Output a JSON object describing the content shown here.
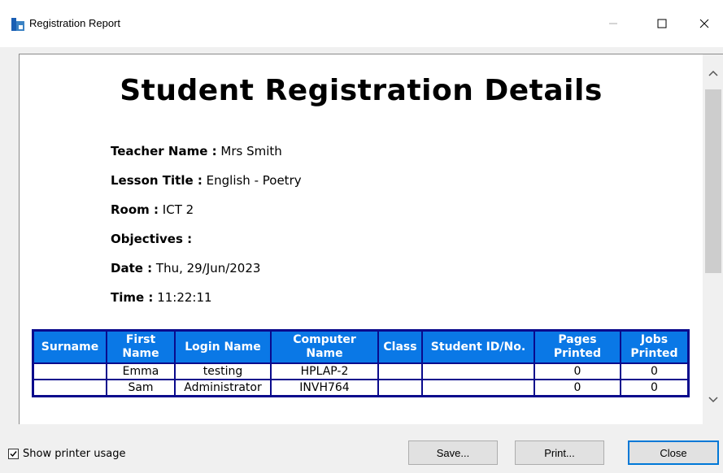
{
  "window": {
    "title": "Registration Report"
  },
  "report": {
    "title": "Student Registration Details",
    "fields": [
      {
        "label": "Teacher Name :",
        "value": "Mrs Smith"
      },
      {
        "label": "Lesson Title :",
        "value": "English - Poetry"
      },
      {
        "label": "Room :",
        "value": "ICT 2"
      },
      {
        "label": "Objectives :",
        "value": ""
      },
      {
        "label": "Date :",
        "value": "Thu, 29/Jun/2023"
      },
      {
        "label": "Time :",
        "value": "11:22:11"
      }
    ],
    "table": {
      "headers": [
        "Surname",
        "First Name",
        "Login Name",
        "Computer Name",
        "Class",
        "Student ID/No.",
        "Pages Printed",
        "Jobs Printed"
      ],
      "rows": [
        [
          "",
          "Emma",
          "testing",
          "HPLAP-2",
          "",
          "",
          "0",
          "0"
        ],
        [
          "",
          "Sam",
          "Administrator",
          "INVH764",
          "",
          "",
          "0",
          "0"
        ]
      ]
    }
  },
  "footer": {
    "show_printer_usage_label": "Show printer usage",
    "show_printer_usage_checked": true,
    "save_label": "Save...",
    "print_label": "Print...",
    "close_label": "Close"
  },
  "colors": {
    "table_header_bg": "#0a78e6",
    "table_border": "#0a0a8c",
    "default_button_border": "#0078d7"
  }
}
